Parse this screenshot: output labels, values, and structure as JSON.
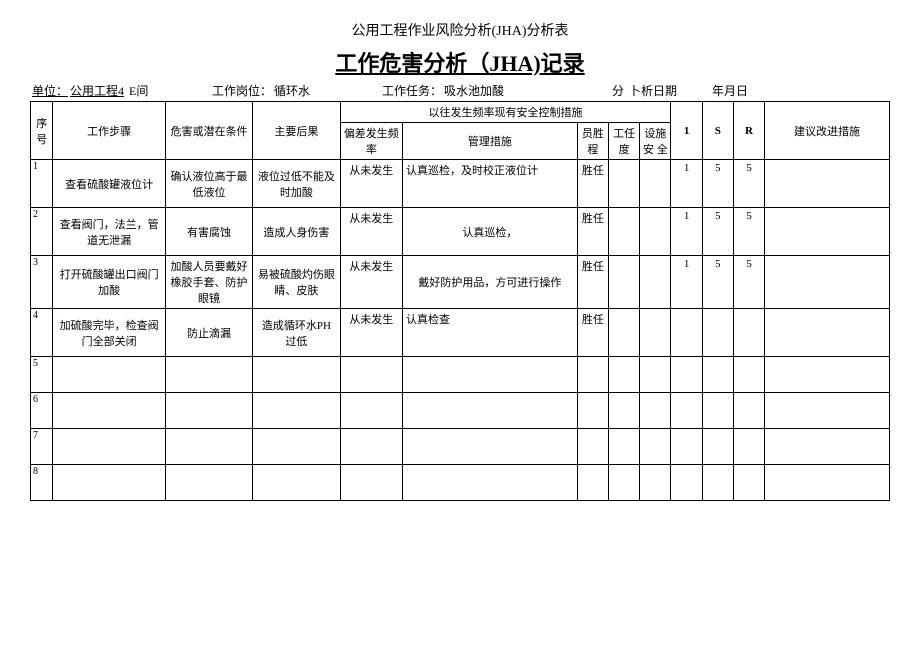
{
  "header": {
    "title_small": "公用工程作业风险分析(JHA)分析表",
    "title_big": "工作危害分析（JHA)记录"
  },
  "meta": {
    "unit_label": "单位：",
    "unit_value": "公用工程4",
    "workshop_suffix": "E间",
    "post_label": "工作岗位：",
    "post_value": "循环水",
    "task_label": "工作任务：",
    "task_value": "吸水池加酸",
    "analysis_prefix": "分",
    "date_label": "卜析日期",
    "date_value": "年月日"
  },
  "columns": {
    "seq": "序号",
    "step": "工作步骤",
    "hazard": "危害或潜在条件",
    "result": "主要后果",
    "freq_control_header": "以往发生频率现有安全控制措施",
    "freq": "偏差发生频率",
    "mgmt": "管理措施",
    "comp": "员胜程",
    "work": "工任度",
    "equip": "设施安",
    "equip2": "全",
    "one": "1",
    "s": "S",
    "r": "R",
    "sugg": "建议改进措施"
  },
  "rows": [
    {
      "seq": "1",
      "step": "查看硫酸罐液位计",
      "hazard": "确认液位高于最低液位",
      "result": "液位过低不能及时加酸",
      "freq": "从未发生",
      "mgmt": "认真巡检，及时校正液位计",
      "comp": "胜任",
      "work": "",
      "equip": "",
      "one": "1",
      "s": "5",
      "r": "5",
      "sugg": ""
    },
    {
      "seq": "2",
      "step": "查看阀门，法兰，管道无泄漏",
      "hazard": "有害腐蚀",
      "result": "造成人身伤害",
      "freq": "从未发生",
      "mgmt": "认真巡检，",
      "comp": "胜任",
      "work": "",
      "equip": "",
      "one": "1",
      "s": "5",
      "r": "5",
      "sugg": ""
    },
    {
      "seq": "3",
      "step": "打开硫酸罐出口阀门加酸",
      "hazard": "加酸人员要戴好橡胶手套、防护眼镜",
      "result": "易被硫酸灼伤眼睛、皮肤",
      "freq": "从未发生",
      "mgmt": "戴好防护用品，方可进行操作",
      "comp": "胜任",
      "work": "",
      "equip": "",
      "one": "1",
      "s": "5",
      "r": "5",
      "sugg": ""
    },
    {
      "seq": "4",
      "step": "加硫酸完毕，检查阀门全部关闭",
      "hazard": "防止滴漏",
      "result": "造成循环水PH 过低",
      "freq": "从未发生",
      "mgmt": "认真检查",
      "comp": "胜任",
      "work": "",
      "equip": "",
      "one": "",
      "s": "",
      "r": "",
      "sugg": ""
    },
    {
      "seq": "5"
    },
    {
      "seq": "6"
    },
    {
      "seq": "7"
    },
    {
      "seq": "8"
    }
  ]
}
